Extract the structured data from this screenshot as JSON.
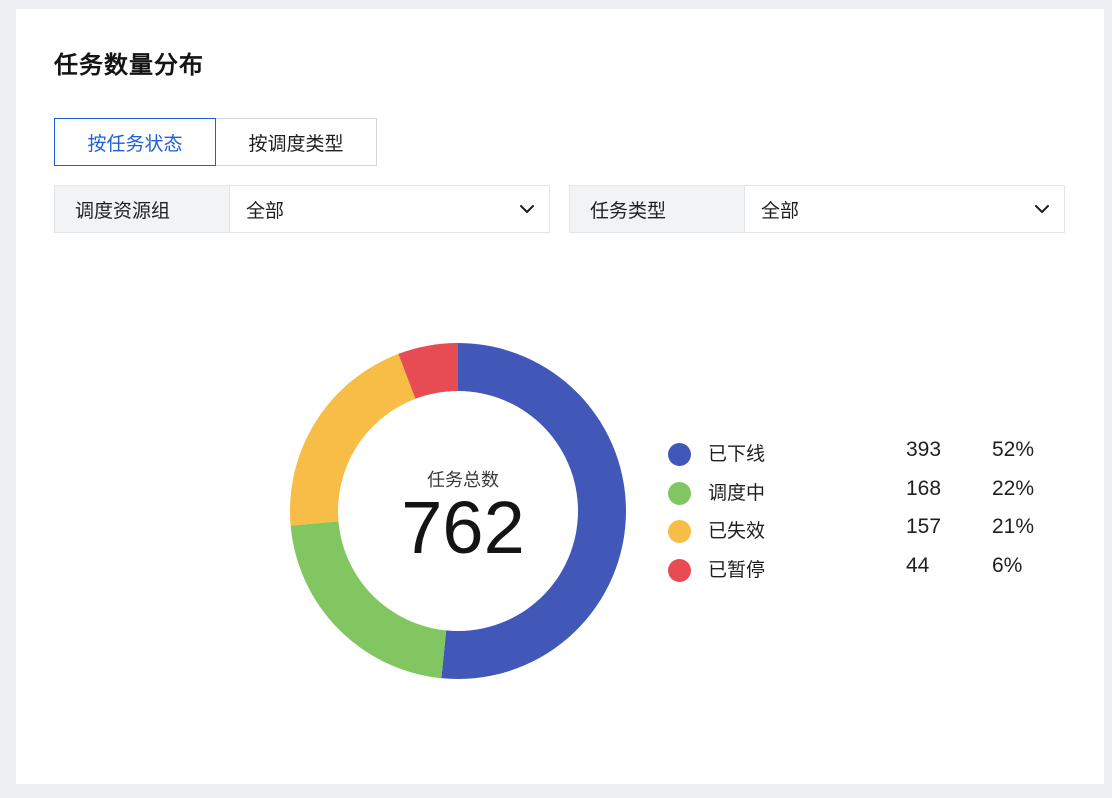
{
  "panel": {
    "title": "任务数量分布"
  },
  "tabs": [
    {
      "label": "按任务状态",
      "active": true
    },
    {
      "label": "按调度类型",
      "active": false
    }
  ],
  "filters": [
    {
      "label": "调度资源组",
      "value": "全部",
      "icon": "chevron-down-icon"
    },
    {
      "label": "任务类型",
      "value": "全部",
      "icon": "chevron-down-icon"
    }
  ],
  "chart_data": {
    "type": "pie",
    "variant": "donut",
    "center_label": "任务总数",
    "center_value": "762",
    "total": 762,
    "categories": [
      "已下线",
      "调度中",
      "已失效",
      "已暂停"
    ],
    "values": [
      393,
      168,
      157,
      44
    ],
    "percent_labels": [
      "52%",
      "22%",
      "21%",
      "6%"
    ],
    "colors": [
      "#4258b9",
      "#82c661",
      "#f8bd46",
      "#e84c53"
    ],
    "legend_placement": "right"
  },
  "colors": {
    "accent": "#1f5fd6",
    "background": "#eef0f4",
    "card": "#ffffff"
  }
}
